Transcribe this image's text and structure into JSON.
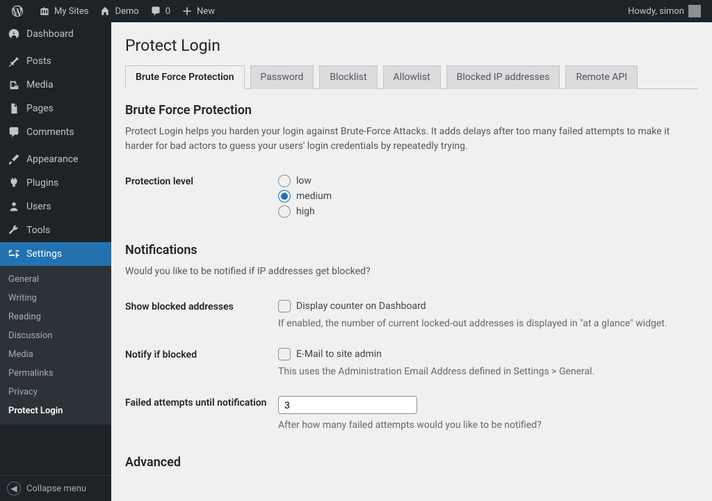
{
  "adminbar": {
    "my_sites": "My Sites",
    "site_name": "Demo",
    "comments": "0",
    "new": "New",
    "howdy": "Howdy, simon"
  },
  "sidebar": {
    "dashboard": "Dashboard",
    "posts": "Posts",
    "media": "Media",
    "pages": "Pages",
    "comments": "Comments",
    "appearance": "Appearance",
    "plugins": "Plugins",
    "users": "Users",
    "tools": "Tools",
    "settings": "Settings",
    "collapse": "Collapse menu"
  },
  "submenu": {
    "general": "General",
    "writing": "Writing",
    "reading": "Reading",
    "discussion": "Discussion",
    "media": "Media",
    "permalinks": "Permalinks",
    "privacy": "Privacy",
    "protect_login": "Protect Login"
  },
  "page": {
    "title": "Protect Login",
    "tabs": {
      "brute": "Brute Force Protection",
      "password": "Password",
      "blocklist": "Blocklist",
      "allowlist": "Allowlist",
      "blocked_ip": "Blocked IP addresses",
      "remote": "Remote API"
    },
    "section1": {
      "heading": "Brute Force Protection",
      "desc": "Protect Login helps you harden your login against Brute-Force Attacks. It adds delays after too many failed attempts to make it harder for bad actors to guess your users' login credentials by repeatedly trying.",
      "protection_label": "Protection level",
      "opt_low": "low",
      "opt_medium": "medium",
      "opt_high": "high"
    },
    "section2": {
      "heading": "Notifications",
      "desc": "Would you like to be notified if IP addresses get blocked?",
      "show_blocked_label": "Show blocked addresses",
      "show_blocked_check": "Display counter on Dashboard",
      "show_blocked_desc": "If enabled, the number of current locked-out addresses is displayed in \"at a glance\" widget.",
      "notify_label": "Notify if blocked",
      "notify_check": "E-Mail to site admin",
      "notify_desc": "This uses the Administration Email Address defined in Settings > General.",
      "attempts_label": "Failed attempts until notification",
      "attempts_value": "3",
      "attempts_desc": "After how many failed attempts would you like to be notified?"
    },
    "section3": {
      "heading": "Advanced"
    }
  }
}
